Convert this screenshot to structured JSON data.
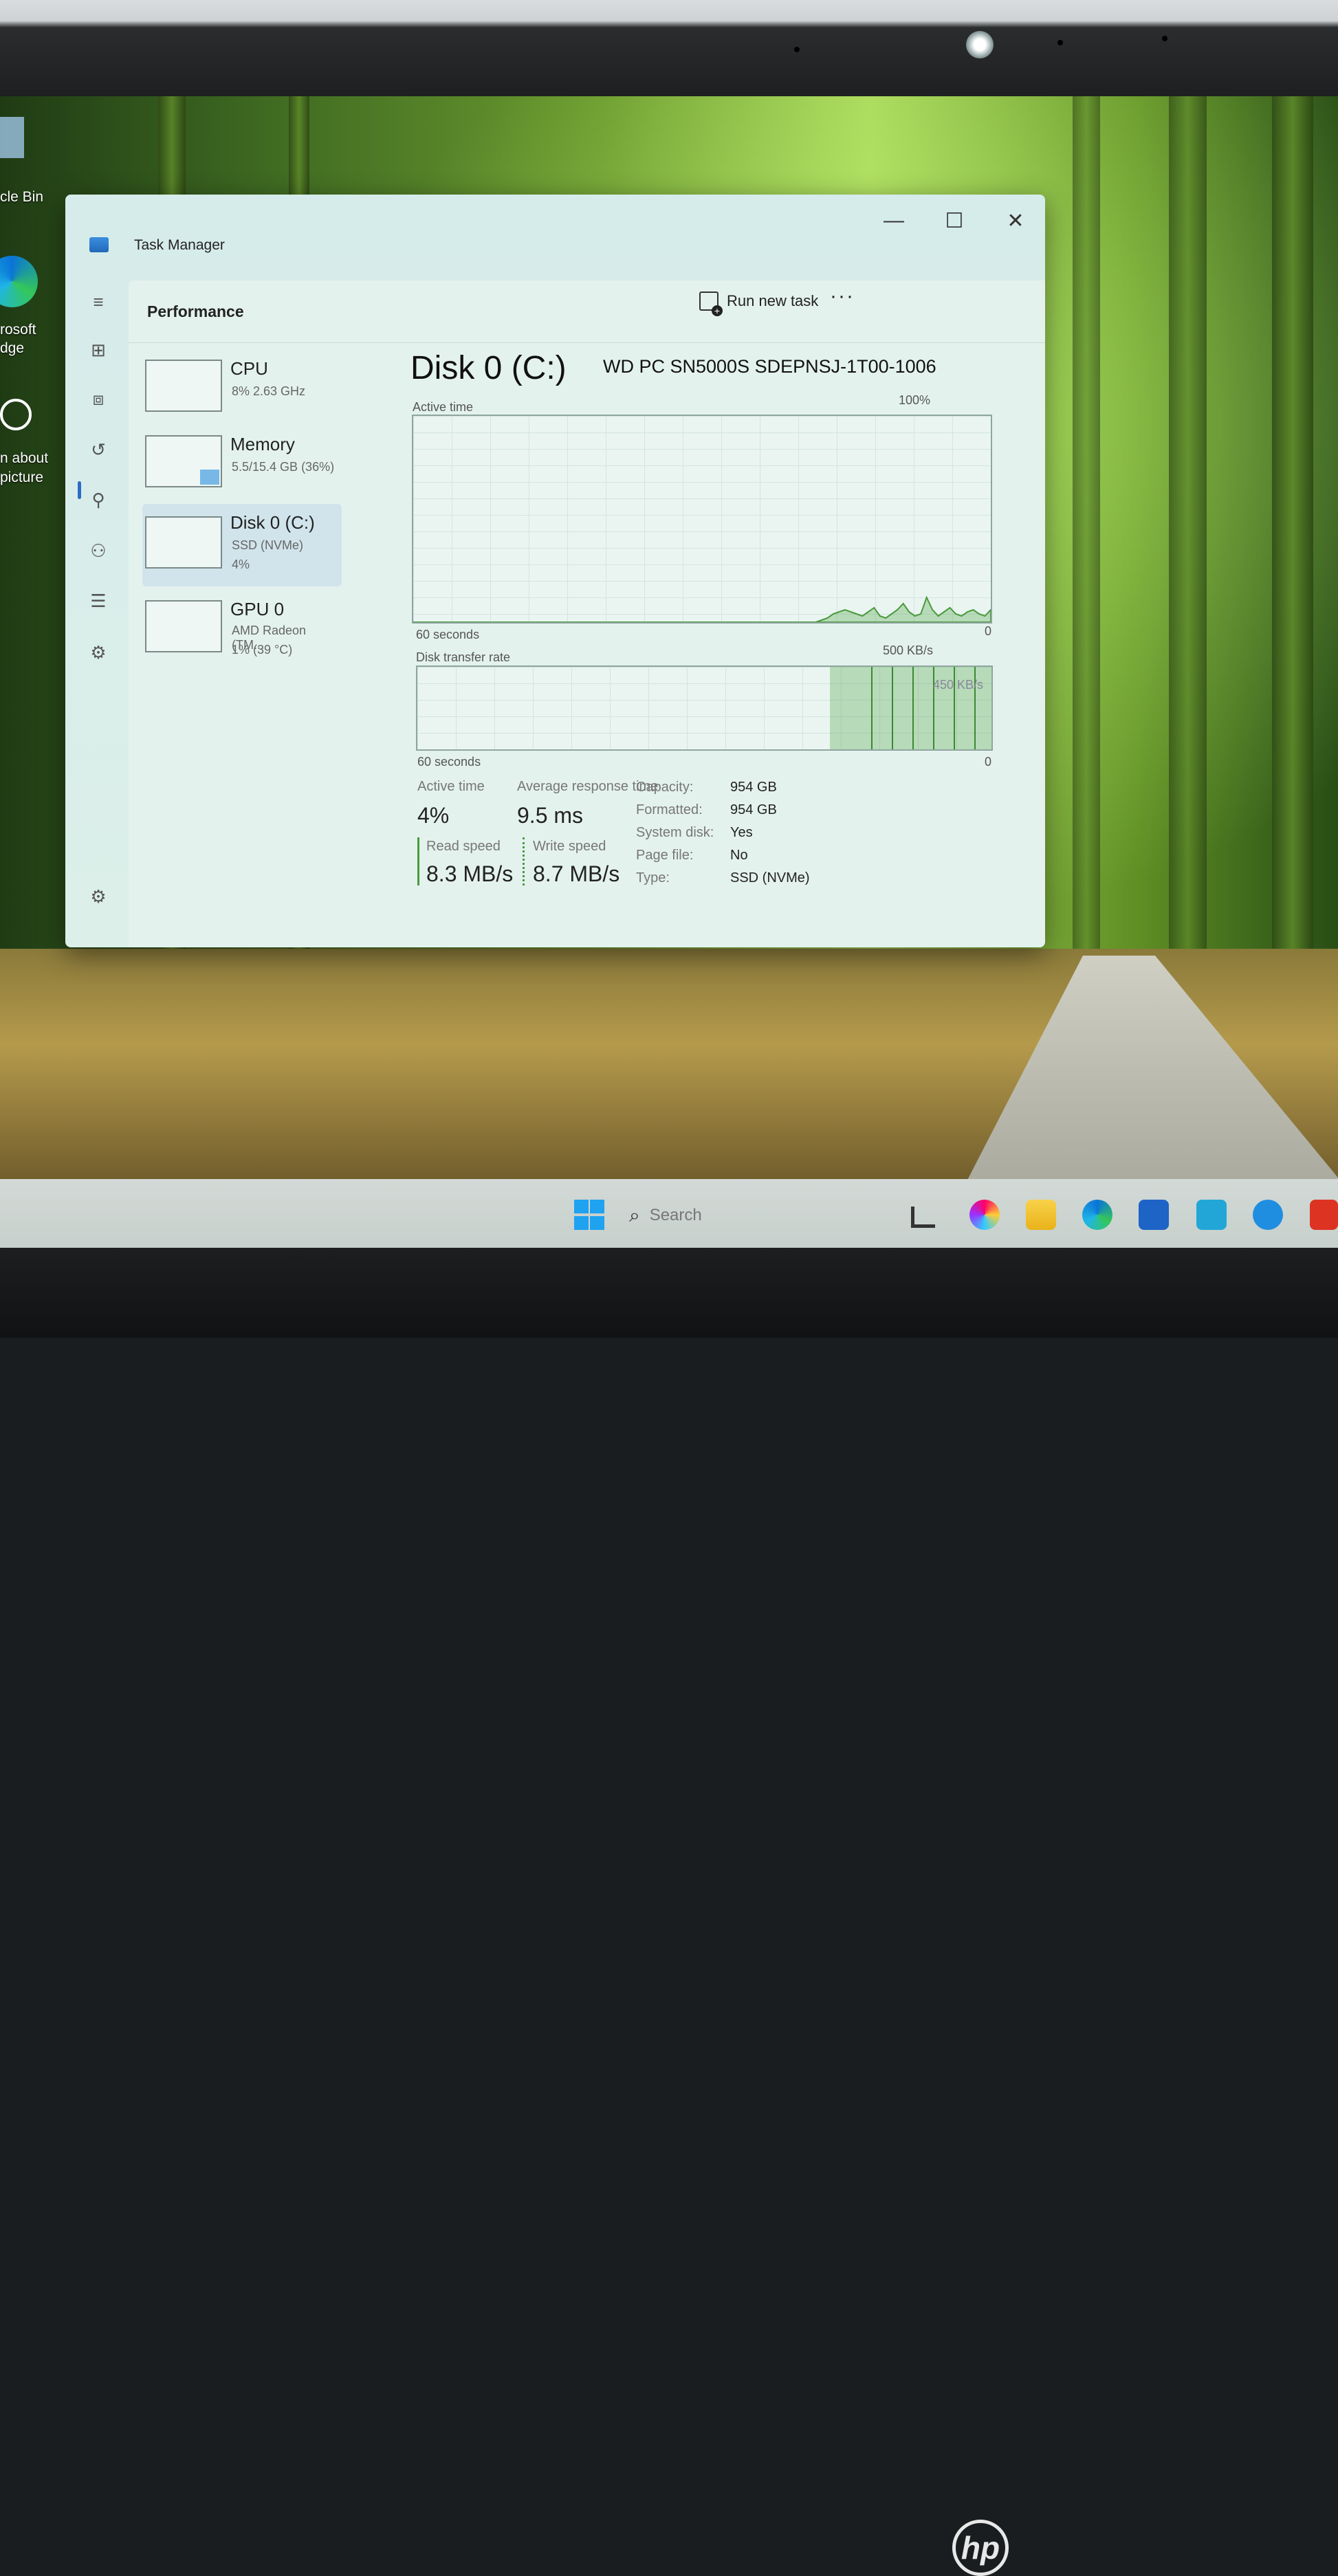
{
  "window": {
    "title": "Task Manager",
    "minimize_glyph": "—",
    "maximize_glyph": "☐",
    "close_glyph": "✕"
  },
  "desktop": {
    "icons": [
      {
        "label": "cle Bin",
        "icon": "recycle-bin-icon"
      },
      {
        "label": "rosoft",
        "icon": "edge-icon"
      },
      {
        "label": "dge",
        "icon": "edge-icon"
      },
      {
        "label": "n about",
        "icon": "learn-about-picture-icon"
      },
      {
        "label": "picture",
        "icon": "learn-about-picture-icon"
      }
    ]
  },
  "header": {
    "page_title": "Performance",
    "run_task_label": "Run new task",
    "more_label": "···"
  },
  "sidebar": {
    "items": [
      {
        "name": "CPU",
        "sub1": "8%  2.63 GHz",
        "sub2": ""
      },
      {
        "name": "Memory",
        "sub1": "5.5/15.4 GB (36%)",
        "sub2": ""
      },
      {
        "name": "Disk 0 (C:)",
        "sub1": "SSD (NVMe)",
        "sub2": "4%"
      },
      {
        "name": "GPU 0",
        "sub1": "AMD Radeon (TM...",
        "sub2": "1%  (39 °C)"
      }
    ]
  },
  "disk": {
    "title": "Disk 0 (C:)",
    "model": "WD PC SN5000S SDEPNSJ-1T00-1006",
    "active_graph": {
      "label": "Active time",
      "max_label": "100%",
      "time_label": "60 seconds",
      "min_label": "0",
      "values": [
        0,
        0,
        0,
        0,
        0,
        0,
        0,
        0,
        0,
        0,
        0,
        0,
        0,
        0,
        0,
        0,
        0,
        0,
        0,
        0,
        0,
        0,
        0,
        0,
        0,
        0,
        0,
        0,
        0,
        0,
        0,
        0,
        0,
        0,
        0,
        0,
        0,
        0,
        0,
        0,
        0,
        0,
        0,
        0,
        0,
        0,
        0,
        0,
        0,
        0,
        0,
        0,
        0,
        0,
        0,
        0,
        0,
        0,
        0,
        0,
        0,
        0,
        0,
        0,
        0,
        0,
        0,
        0,
        0,
        0,
        1,
        2,
        4,
        5,
        6,
        5,
        4,
        3,
        5,
        7,
        3,
        2,
        4,
        6,
        9,
        5,
        3,
        4,
        12,
        6,
        3,
        5,
        7,
        4,
        3,
        5,
        6,
        4,
        3,
        6
      ]
    },
    "transfer_graph": {
      "label": "Disk transfer rate",
      "max_label": "500 KB/s",
      "inner_label": "450 KB/s",
      "time_label": "60 seconds",
      "min_label": "0"
    },
    "stats": {
      "active_time_label": "Active time",
      "active_time_value": "4%",
      "avg_response_label": "Average response time",
      "avg_response_value": "9.5 ms",
      "read_label": "Read speed",
      "read_value": "8.3 MB/s",
      "write_label": "Write speed",
      "write_value": "8.7 MB/s"
    },
    "properties": [
      {
        "label": "Capacity:",
        "value": "954 GB"
      },
      {
        "label": "Formatted:",
        "value": "954 GB"
      },
      {
        "label": "System disk:",
        "value": "Yes"
      },
      {
        "label": "Page file:",
        "value": "No"
      },
      {
        "label": "Type:",
        "value": "SSD (NVMe)"
      }
    ]
  },
  "taskbar": {
    "search_placeholder": "Search"
  },
  "colors": {
    "disk_green": "#4a9a3c",
    "accent_blue": "#2c6cc4"
  }
}
